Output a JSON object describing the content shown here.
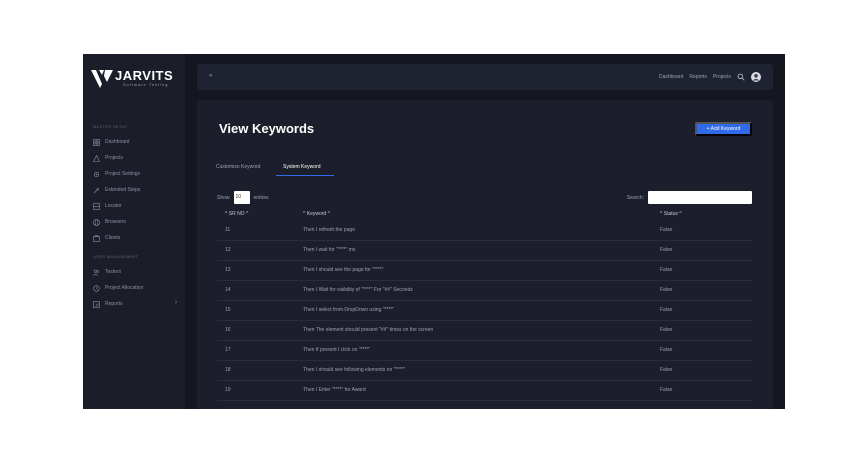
{
  "brand": {
    "title": "JARVITS",
    "subtitle": "Software Testing"
  },
  "sidebar": {
    "sections": [
      {
        "label": "MASTER SETUP",
        "items": [
          {
            "label": "Dashboard",
            "icon": "grid-icon"
          },
          {
            "label": "Projects",
            "icon": "triangle-icon"
          },
          {
            "label": "Project Settings",
            "icon": "gear-icon"
          },
          {
            "label": "Extended Steps",
            "icon": "wrench-icon"
          },
          {
            "label": "Locator",
            "icon": "locator-icon"
          },
          {
            "label": "Browsers",
            "icon": "globe-icon"
          },
          {
            "label": "Clients",
            "icon": "clients-icon"
          }
        ]
      },
      {
        "label": "USER MANAGEMENT",
        "items": [
          {
            "label": "Testers",
            "icon": "users-icon"
          },
          {
            "label": "Project Allocation",
            "icon": "allocation-icon"
          },
          {
            "label": "Reports",
            "icon": "report-icon",
            "chevron": "›"
          }
        ]
      }
    ]
  },
  "topbar": {
    "collapse_label": "«",
    "links": [
      "Dashboard",
      "Reports",
      "Projects"
    ]
  },
  "page": {
    "title": "View Keywords",
    "add_button": "+ Add Keyword"
  },
  "tabs": [
    {
      "label": "Customize Keyword",
      "active": false
    },
    {
      "label": "System Keyword",
      "active": true
    }
  ],
  "controls": {
    "show_label": "Show",
    "entries_value": "10",
    "entries_label": "entries",
    "search_label": "Search:",
    "search_value": ""
  },
  "table": {
    "headers": [
      "^ SR NO ^",
      "^ Keyword ^",
      "^ Status ^"
    ],
    "rows": [
      [
        "11",
        "Then I refresh the page",
        "False"
      ],
      [
        "12",
        "Then I wait for \"****\" ms",
        "False"
      ],
      [
        "13",
        "Then I should see the page for \"****\"",
        "False"
      ],
      [
        "14",
        "Then I Wait for visibility of \"****\" For \"##\" Seconds",
        "False"
      ],
      [
        "15",
        "Then I select from DropDown using \"****\"",
        "False"
      ],
      [
        "16",
        "Then The element should present \"##\" times on the screen",
        "False"
      ],
      [
        "17",
        "Then If present I click on \"****\"",
        "False"
      ],
      [
        "18",
        "Then I should see following elements on \"****\"",
        "False"
      ],
      [
        "19",
        "Then I Enter \"****\" for Award",
        "False"
      ]
    ]
  },
  "colors": {
    "accent": "#2f6be8",
    "background": "#141620",
    "sidebar": "#1b1d29",
    "panel": "#1c1f2b"
  }
}
